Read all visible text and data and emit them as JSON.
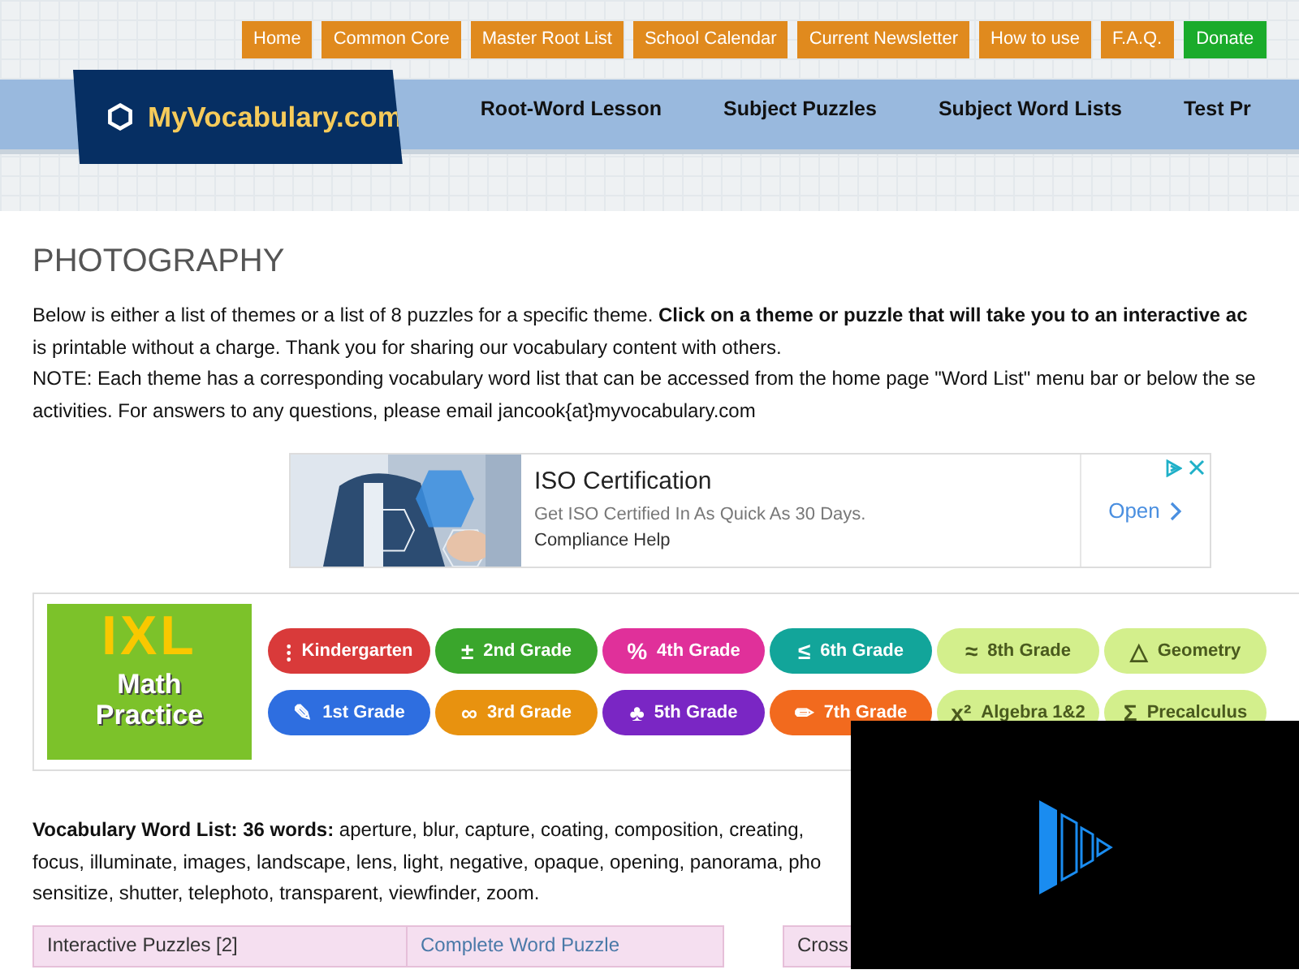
{
  "top_menu": [
    {
      "label": "Home",
      "kind": "link"
    },
    {
      "label": "Common Core",
      "kind": "link"
    },
    {
      "label": "Master Root List",
      "kind": "link"
    },
    {
      "label": "School Calendar",
      "kind": "link"
    },
    {
      "label": "Current Newsletter",
      "kind": "link"
    },
    {
      "label": "How to use",
      "kind": "link"
    },
    {
      "label": "F.A.Q.",
      "kind": "link"
    },
    {
      "label": "Donate",
      "kind": "donate"
    }
  ],
  "logo": {
    "text": "MyVocabulary.com"
  },
  "main_nav": [
    "Root-Word Lesson",
    "Subject Puzzles",
    "Subject Word Lists",
    "Test Pr"
  ],
  "page_title": "PHOTOGRAPHY",
  "intro_lines": [
    "Below is either a list of themes or a list of 8 puzzles for a specific theme. **Click on a theme or puzzle that will take you to an interactive ac**",
    "is printable without a charge. Thank you for sharing our vocabulary content with others.",
    "NOTE: Each theme has a corresponding vocabulary word list that can be accessed from the home page \"Word List\" menu bar or below the se",
    "activities. For answers to any questions, please email jancook{at}myvocabulary.com"
  ],
  "ad": {
    "title": "ISO Certification",
    "subtitle": "Get ISO Certified In As Quick As 30 Days.",
    "advertiser": "Compliance Help",
    "action": "Open"
  },
  "ixl_ad": {
    "logo": "IXL",
    "caption_lines": [
      "Math",
      "Practice"
    ],
    "grades": [
      {
        "label": "Kindergarten",
        "symbol": "⁝",
        "color": "#d93a3a"
      },
      {
        "label": "2nd Grade",
        "symbol": "±",
        "color": "#3aa62c"
      },
      {
        "label": "4th Grade",
        "symbol": "%",
        "color": "#e0309a"
      },
      {
        "label": "6th Grade",
        "symbol": "≤",
        "color": "#12a59a"
      },
      {
        "label": "8th Grade",
        "symbol": "≈",
        "color": "#d3ef8c"
      },
      {
        "label": "Geometry",
        "symbol": "△",
        "color": "#d3ef8c"
      },
      {
        "label": "1st Grade",
        "symbol": "✎",
        "color": "#2e6ee0"
      },
      {
        "label": "3rd Grade",
        "symbol": "∞",
        "color": "#e8920f"
      },
      {
        "label": "5th Grade",
        "symbol": "♣",
        "color": "#7a26c4"
      },
      {
        "label": "7th Grade",
        "symbol": "✏",
        "color": "#f26a1e"
      },
      {
        "label": "Algebra 1&2",
        "symbol": "x²",
        "color": "#d3ef8c"
      },
      {
        "label": "Precalculus",
        "symbol": "Σ",
        "color": "#d3ef8c"
      }
    ]
  },
  "word_list_lines": [
    "**Vocabulary Word List: 36 words:** aperture, blur, capture, coating, composition, creating,",
    "focus, illuminate, images, landscape, lens, light, negative, opaque, opening, panorama, pho",
    "sensitize, shutter, telephoto, transparent, viewfinder, zoom."
  ],
  "tables": [
    {
      "cells": [
        "Interactive Puzzles [2]",
        "Complete Word Puzzle"
      ]
    },
    {
      "cells": [
        "Cross"
      ]
    }
  ]
}
